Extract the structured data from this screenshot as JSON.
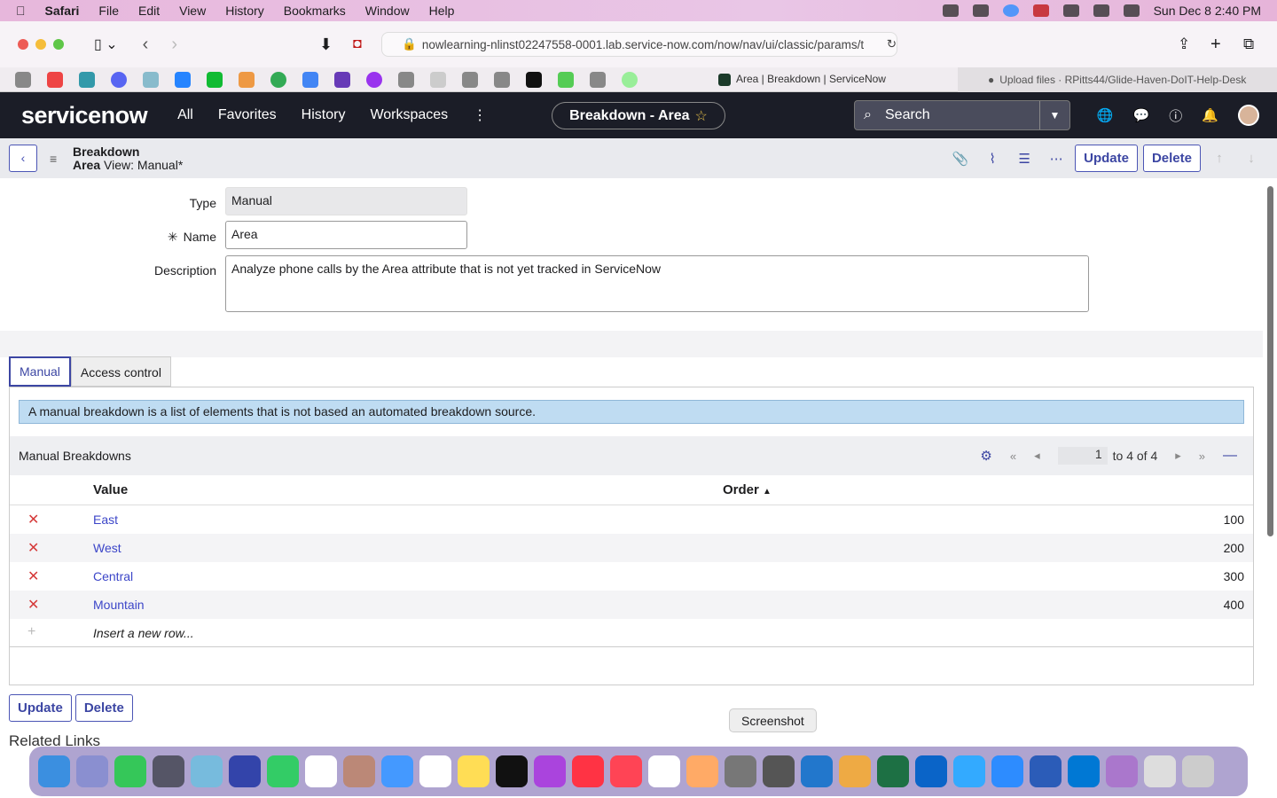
{
  "menubar": {
    "apple": "",
    "app": "Safari",
    "items": [
      "File",
      "Edit",
      "View",
      "History",
      "Bookmarks",
      "Window",
      "Help"
    ],
    "clock": "Sun Dec 8  2:40 PM"
  },
  "browser": {
    "url": "nowlearning-nlinst02247558-0001.lab.service-now.com/now/nav/ui/classic/params/t",
    "tabs": [
      "Area | Breakdown | ServiceNow",
      "Upload files · RPitts44/Glide-Haven-DoIT-Help-Desk"
    ]
  },
  "sn": {
    "logo": "servicenow",
    "nav": [
      "All",
      "Favorites",
      "History",
      "Workspaces"
    ],
    "context_pill": "Breakdown - Area",
    "search_placeholder": "Search"
  },
  "header": {
    "title": "Breakdown",
    "subtitle": "Area",
    "view": "View: Manual*",
    "update": "Update",
    "delete": "Delete"
  },
  "form": {
    "type_label": "Type",
    "type_value": "Manual",
    "name_label": "Name",
    "name_value": "Area",
    "description_label": "Description",
    "description_value": "Analyze phone calls by the Area attribute that is not yet tracked in ServiceNow"
  },
  "tabs": [
    "Manual",
    "Access control"
  ],
  "info": "A manual breakdown is a list of elements that is not based an automated breakdown source.",
  "list": {
    "title": "Manual Breakdowns",
    "page": "1",
    "page_range": "to 4 of 4",
    "columns": [
      "Value",
      "Order"
    ],
    "rows": [
      {
        "value": "East",
        "order": "100"
      },
      {
        "value": "West",
        "order": "200"
      },
      {
        "value": "Central",
        "order": "300"
      },
      {
        "value": "Mountain",
        "order": "400"
      }
    ],
    "insert": "Insert a new row..."
  },
  "footer": {
    "update": "Update",
    "delete": "Delete",
    "related": "Related Links"
  },
  "tooltip": "Screenshot",
  "colors": {
    "accent": "#3c46a3",
    "nav_bg": "#1b1d27",
    "info_bg": "#bfdcf2",
    "delete_x": "#d53a3a"
  }
}
